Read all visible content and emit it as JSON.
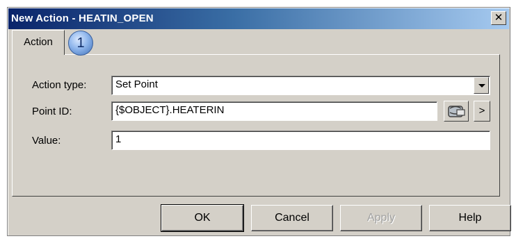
{
  "window": {
    "title": "New Action - HEATIN_OPEN",
    "close_glyph": "✕"
  },
  "tabs": [
    {
      "label": "Action",
      "selected": true
    }
  ],
  "badge": {
    "number": "1",
    "color": "#8fb6ec"
  },
  "form": {
    "action_type_label": "Action type:",
    "action_type_value": "Set Point",
    "point_id_label": "Point ID:",
    "point_id_value": "{$OBJECT}.HEATERIN",
    "point_browse_icon": "database-browse-icon",
    "point_more_glyph": ">",
    "value_label": "Value:",
    "value_value": "1"
  },
  "buttons": {
    "ok": "OK",
    "cancel": "Cancel",
    "apply": "Apply",
    "help": "Help"
  },
  "colors": {
    "title_start": "#0a246a",
    "title_end": "#a6caf0",
    "dialog_face": "#d4d0c8"
  }
}
